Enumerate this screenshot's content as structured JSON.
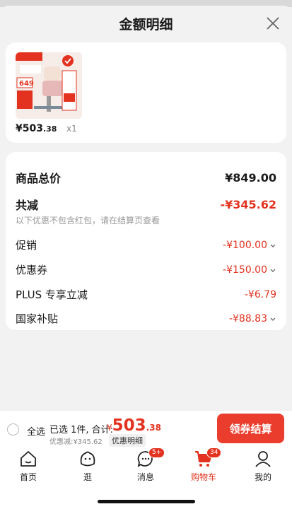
{
  "sheet": {
    "title": "金额明细"
  },
  "product": {
    "price_int": "¥503",
    "price_dec": ".38",
    "qty": "x1",
    "thumb_price": "649"
  },
  "details": {
    "total_label": "商品总价",
    "total_value": "¥849.00",
    "reduce_label": "共减",
    "reduce_value": "-¥345.62",
    "note": "以下优惠不包含红包，请在结算页查看",
    "items": [
      {
        "label": "促销",
        "value": "-¥100.00"
      },
      {
        "label": "优惠券",
        "value": "-¥150.00"
      },
      {
        "label": "PLUS 专享立减",
        "value": "-¥6.79"
      },
      {
        "label": "国家补贴",
        "value": "-¥88.83"
      }
    ]
  },
  "checkout": {
    "select_all": "全选",
    "selected": "已选 1件, 合计:",
    "currency": "¥",
    "sum_int": "503",
    "sum_dec": ".38",
    "saved": "优惠减:¥345.62",
    "detail_link": "优惠明细",
    "pay_button": "领券结算"
  },
  "tabs": [
    {
      "label": "首页",
      "icon": "home-icon"
    },
    {
      "label": "逛",
      "icon": "browse-icon"
    },
    {
      "label": "消息",
      "icon": "message-icon",
      "badge": "5+"
    },
    {
      "label": "购物车",
      "icon": "cart-icon",
      "badge": "34",
      "active": true
    },
    {
      "label": "我的",
      "icon": "profile-icon"
    }
  ],
  "colors": {
    "accent": "#e3321f",
    "button": "#ea3d2d"
  }
}
